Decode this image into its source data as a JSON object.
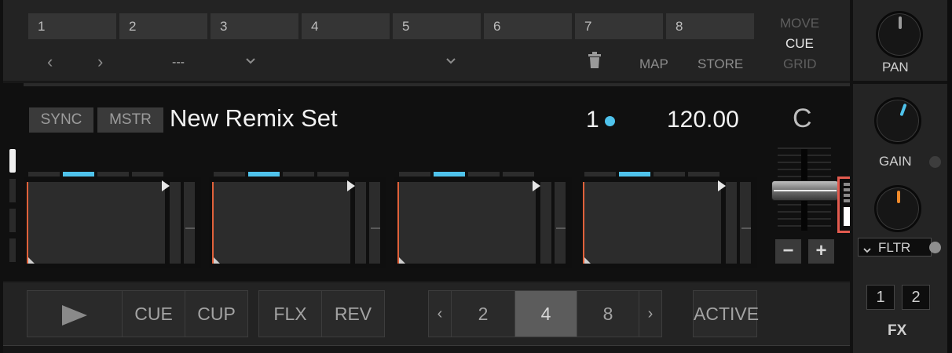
{
  "cue_bar": {
    "slots": [
      "1",
      "2",
      "3",
      "4",
      "5",
      "6",
      "7",
      "8"
    ],
    "prev": "‹",
    "next": "›",
    "mode_value": "---",
    "map_label": "MAP",
    "store_label": "STORE",
    "modes": [
      "MOVE",
      "CUE",
      "GRID"
    ],
    "active_mode": "CUE"
  },
  "deck": {
    "sync_label": "SYNC",
    "master_label": "MSTR",
    "title": "New Remix Set",
    "beat_number": "1",
    "bpm": "120.00",
    "key": "C",
    "accent_color": "#4fc3ec"
  },
  "transport": {
    "play_icon": "play-icon",
    "cue_label": "CUE",
    "cup_label": "CUP",
    "flx_label": "FLX",
    "rev_label": "REV",
    "loop_sizes": [
      "2",
      "4",
      "8"
    ],
    "loop_selected": "4",
    "active_label": "ACTIVE"
  },
  "mixer": {
    "pan_label": "PAN",
    "gain_label": "GAIN",
    "filter_label": "FLTR",
    "fx_label": "FX",
    "fx_buttons": [
      "1",
      "2"
    ],
    "tempo_minus": "−",
    "tempo_plus": "+"
  }
}
